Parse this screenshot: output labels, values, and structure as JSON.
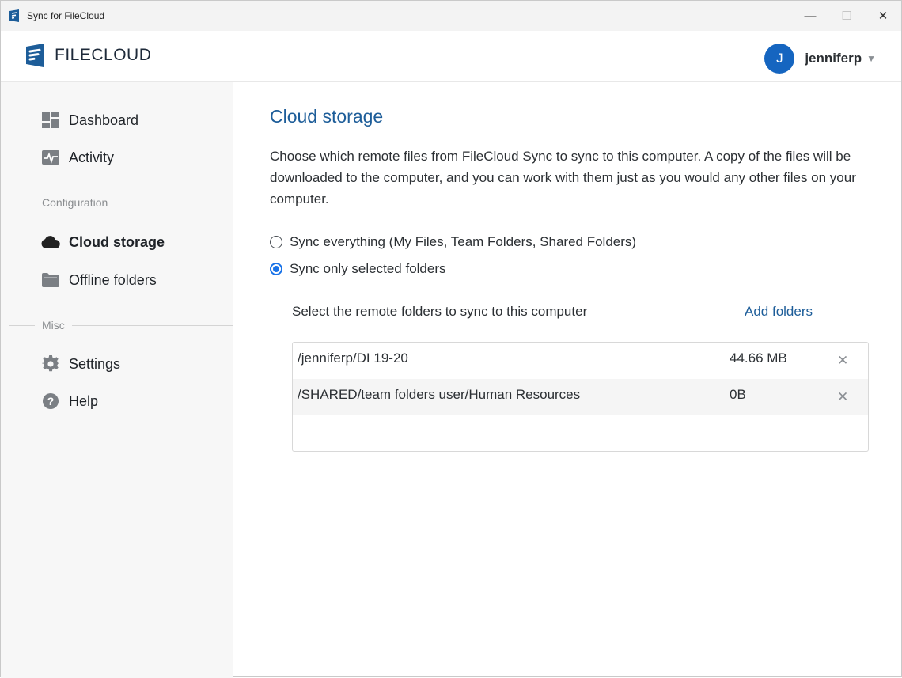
{
  "window": {
    "title": "Sync for FileCloud"
  },
  "header": {
    "logo_text": "FILECLOUD",
    "user_initial": "J",
    "username": "jenniferp"
  },
  "sidebar": {
    "items": [
      {
        "label": "Dashboard",
        "icon": "dashboard-icon"
      },
      {
        "label": "Activity",
        "icon": "activity-icon"
      },
      {
        "label": "Cloud storage",
        "icon": "cloud-icon",
        "active": true
      },
      {
        "label": "Offline folders",
        "icon": "folder-icon"
      },
      {
        "label": "Settings",
        "icon": "gear-icon"
      },
      {
        "label": "Help",
        "icon": "help-icon"
      }
    ],
    "sections": {
      "configuration": "Configuration",
      "misc": "Misc"
    }
  },
  "main": {
    "title": "Cloud storage",
    "description": "Choose which remote files from FileCloud Sync to sync to this computer. A copy of the files will be downloaded to the computer, and you can work with them just as you would any other files on your computer.",
    "options": [
      {
        "label": "Sync everything (My Files, Team Folders, Shared Folders)",
        "selected": false
      },
      {
        "label": "Sync only selected folders",
        "selected": true
      }
    ],
    "select_label": "Select the remote folders to sync to this computer",
    "add_folders": "Add folders",
    "folders": [
      {
        "path": "/jenniferp/DI 19-20",
        "size": "44.66 MB",
        "remove": "✕"
      },
      {
        "path": "/SHARED/team folders user/Human Resources",
        "size": "0B",
        "remove": "✕"
      }
    ]
  },
  "colors": {
    "accent": "#1d5d99",
    "avatar": "#1565c0",
    "radio": "#1a73e8"
  }
}
